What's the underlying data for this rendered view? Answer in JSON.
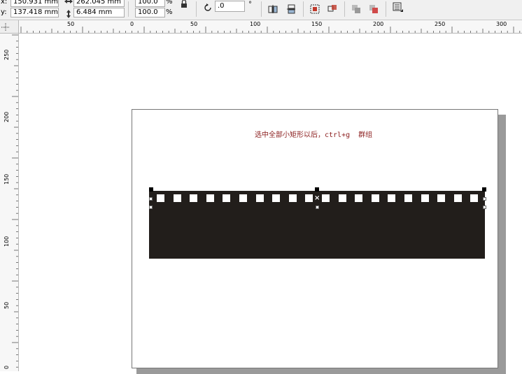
{
  "toolbar": {
    "x_label": "x:",
    "x_value": "150.931 mm",
    "y_label": "y:",
    "y_value": "137.418 mm",
    "width_value": "262.045 mm",
    "height_value": "6.484 mm",
    "scale_x": "100.0",
    "scale_y": "100.0",
    "percent_symbol": "%",
    "rotation_value": ".0",
    "degree_symbol": "°"
  },
  "ruler_top_labels": [
    "50",
    "0",
    "50",
    "100",
    "150",
    "200",
    "250",
    "300"
  ],
  "ruler_left_labels": [
    "250",
    "200",
    "150",
    "100",
    "50",
    "0"
  ],
  "canvas": {
    "annotation": "选中全部小矩形以后，ctrl+g  群组"
  },
  "colors": {
    "film_strip": "#221e1b",
    "annotation_text": "#8b1d1d",
    "page_shadow": "#9a9a9a"
  },
  "icons": [
    "lock-ratio-icon",
    "rotate-icon",
    "mirror-horizontal-icon",
    "mirror-vertical-icon",
    "group-icon",
    "ungroup-icon",
    "combine-icon",
    "break-apart-icon",
    "wrap-text-icon"
  ]
}
